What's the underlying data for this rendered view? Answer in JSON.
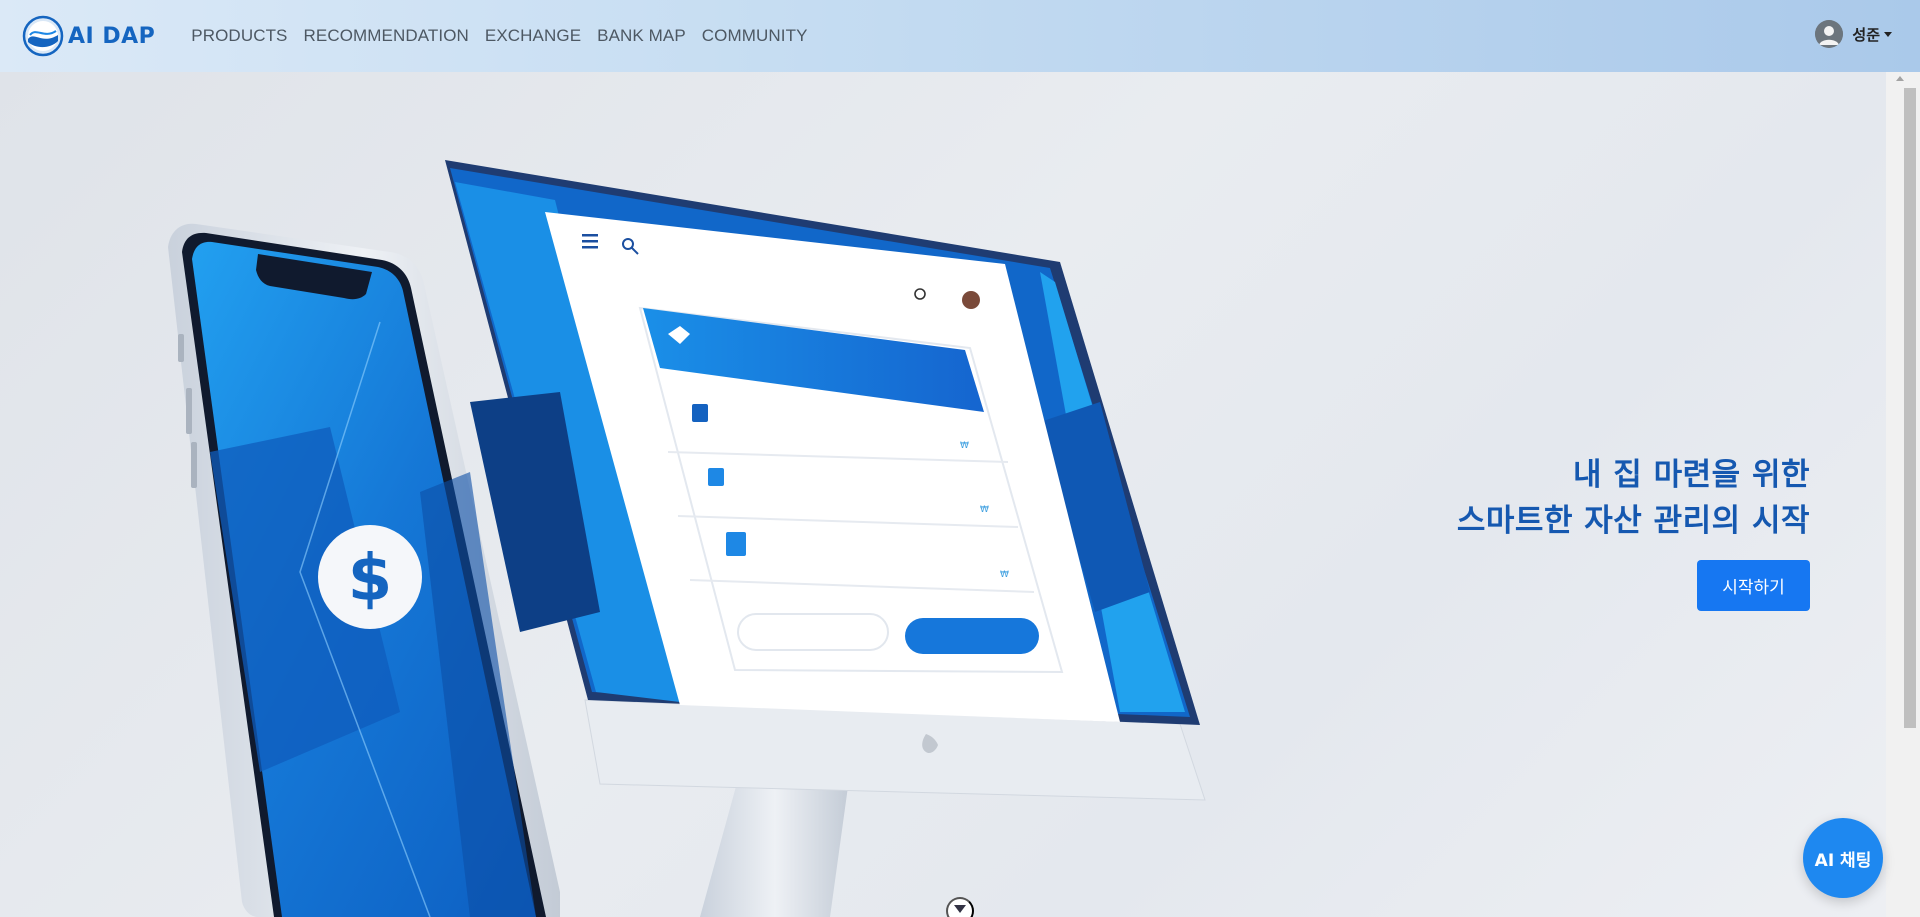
{
  "brand": {
    "name": "AI DAP",
    "logo_icon": "wave-globe-logo"
  },
  "nav": {
    "items": [
      {
        "label": "PRODUCTS"
      },
      {
        "label": "RECOMMENDATION"
      },
      {
        "label": "EXCHANGE"
      },
      {
        "label": "BANK MAP"
      },
      {
        "label": "COMMUNITY"
      }
    ]
  },
  "user": {
    "name": "성준",
    "avatar_icon": "user-avatar-icon",
    "menu_icon": "caret-down-icon"
  },
  "hero": {
    "headline_line1": "내 집 마련을 위한",
    "headline_line2": "스마트한 자산 관리의 시작",
    "cta_label": "시작하기",
    "illustration": "phone-and-monitor-finance-app"
  },
  "chat": {
    "label": "AI 채팅"
  },
  "colors": {
    "accent": "#1677f2",
    "headline": "#1558b0",
    "brand": "#1565c0",
    "navbar_start": "#dbe9f7",
    "navbar_end": "#aac9ea"
  }
}
